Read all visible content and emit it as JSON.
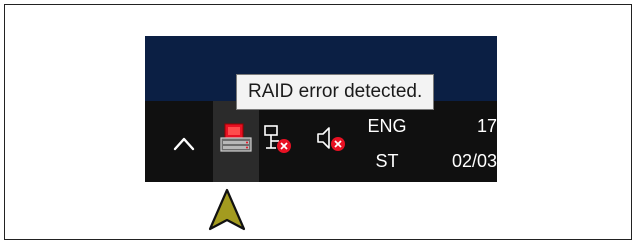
{
  "tooltip": {
    "text": "RAID error detected."
  },
  "tray": {
    "chevron_icon": "chevron-up-icon",
    "icons": [
      {
        "name": "raid-status-icon",
        "state": "error"
      },
      {
        "name": "network-icon",
        "state": "disconnected"
      },
      {
        "name": "volume-icon",
        "state": "muted"
      }
    ]
  },
  "language": {
    "code": "ENG",
    "mode": "ST"
  },
  "clock": {
    "time": "17",
    "date": "02/03"
  },
  "colors": {
    "taskbar": "#101010",
    "desktop": "#0b1f44",
    "tooltip_bg": "#f3f3f3",
    "error_red": "#e81123",
    "highlight_arrow": "#a39b1f"
  }
}
